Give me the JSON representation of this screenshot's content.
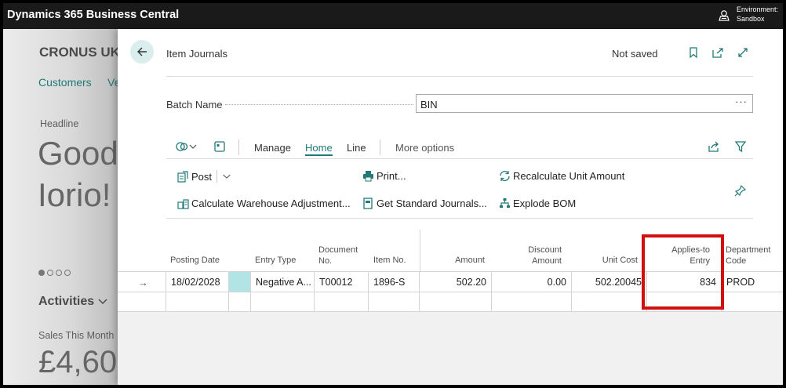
{
  "app": {
    "title": "Dynamics 365 Business Central",
    "environment_line1": "Environment:",
    "environment_line2": "Sandbox"
  },
  "background": {
    "company": "CRONUS UK",
    "nav_customers": "Customers",
    "nav_next": "Ve",
    "headline_label": "Headline",
    "greeting_line1": "Good",
    "greeting_line2": "Iorio!",
    "activities_label": "Activities",
    "sales_label": "Sales This Month",
    "sales_amount": "£4,60"
  },
  "panel": {
    "caption": "Item Journals",
    "status": "Not saved",
    "batch_label": "Batch Name",
    "batch_value": "BIN",
    "batch_ellipsis": "···"
  },
  "actionbar": {
    "tabs": [
      "Manage",
      "Home",
      "Line"
    ],
    "active_tab": "Home",
    "more": "More options"
  },
  "actions": {
    "post": "Post",
    "print": "Print...",
    "recalc": "Recalculate Unit Amount",
    "calc_wh": "Calculate Warehouse Adjustment...",
    "get_std": "Get Standard Journals...",
    "explode": "Explode BOM"
  },
  "grid": {
    "headers": {
      "posting_date": "Posting Date",
      "entry_type": "Entry Type",
      "document_no_1": "Document",
      "document_no_2": "No.",
      "item_no": "Item No.",
      "amount": "Amount",
      "discount_1": "Discount",
      "discount_2": "Amount",
      "unit_cost": "Unit Cost",
      "applies_1": "Applies-to",
      "applies_2": "Entry",
      "department_1": "Department",
      "department_2": "Code"
    },
    "rows": [
      {
        "posting_date": "18/02/2028",
        "entry_type": "Negative A...",
        "document_no": "T00012",
        "item_no": "1896-S",
        "amount": "502.20",
        "discount_amount": "0.00",
        "unit_cost": "502.20045",
        "applies_to_entry": "834",
        "department_code": "PROD"
      }
    ]
  },
  "colors": {
    "accent": "#227a77",
    "highlight": "#d20f0f",
    "topbar": "#1a1a1a",
    "selected_cell": "#b2e4e6"
  }
}
